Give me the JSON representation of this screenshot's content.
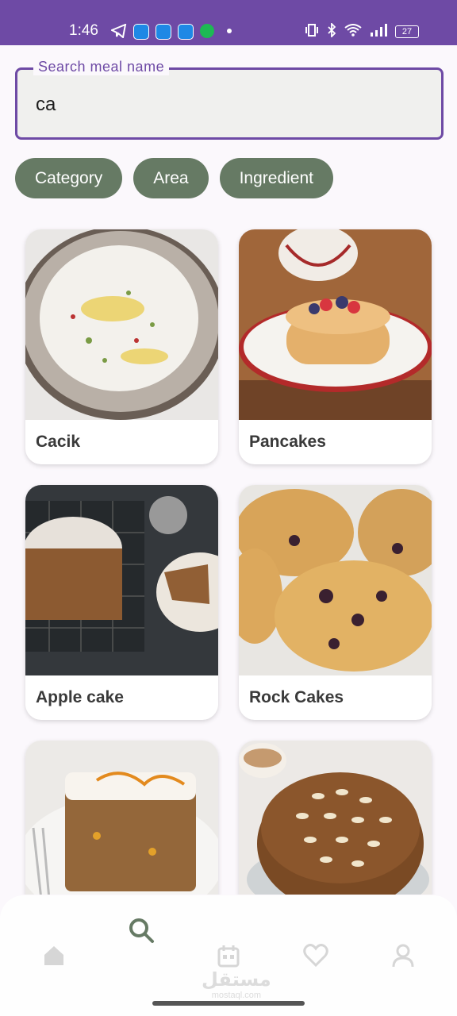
{
  "status_bar": {
    "time": "1:46",
    "battery": "27"
  },
  "search": {
    "label": "Search meal name",
    "value": "ca"
  },
  "filters": [
    {
      "label": "Category"
    },
    {
      "label": "Area"
    },
    {
      "label": "Ingredient"
    }
  ],
  "meals": [
    {
      "name": "Cacik"
    },
    {
      "name": "Pancakes"
    },
    {
      "name": "Apple cake"
    },
    {
      "name": "Rock Cakes"
    },
    {
      "name": ""
    },
    {
      "name": ""
    }
  ],
  "nav": {
    "active": "search"
  },
  "watermark": {
    "text": "مستقل",
    "sub": "mostaql.com"
  },
  "colors": {
    "primary": "#6e4aa5",
    "chip": "#667a64",
    "nav_active": "#667a64",
    "nav_inactive": "#d6d6d6"
  }
}
